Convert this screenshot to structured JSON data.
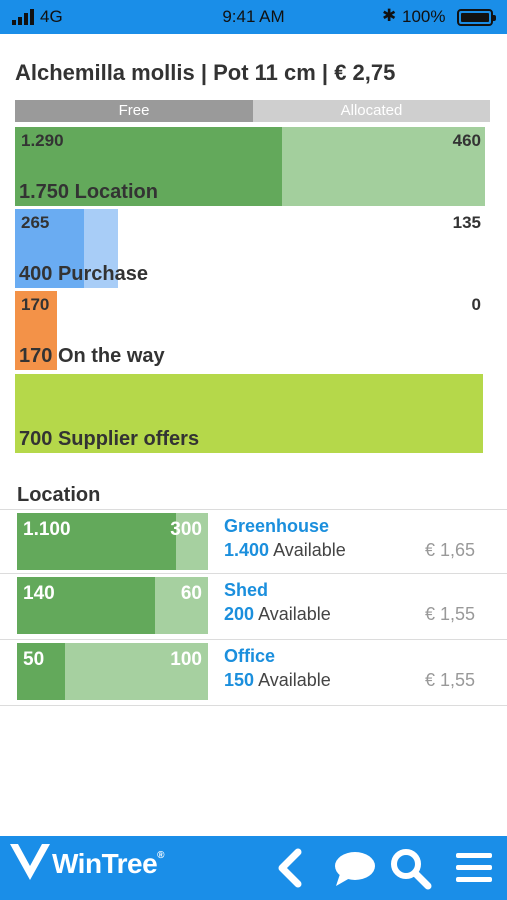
{
  "status_bar": {
    "network": "4G",
    "time": "9:41 AM",
    "battery": "100%"
  },
  "product": {
    "title": "Alchemilla mollis | Pot 11 cm | € 2,75"
  },
  "legend": {
    "free": "Free",
    "allocated": "Allocated"
  },
  "stock_rows": [
    {
      "free": "1.290",
      "allocated": "460",
      "total": "1.750",
      "label": "Location",
      "color_free": "#63a95b",
      "color_alloc": "#a3cf9d"
    },
    {
      "free": "265",
      "allocated": "135",
      "total": "400",
      "label": "Purchase",
      "color_free": "#6aacf2",
      "color_alloc": "#a8cdf7"
    },
    {
      "free": "170",
      "allocated": "0",
      "total": "170",
      "label": "On the way",
      "color_free": "#f39248",
      "color_alloc": "#f8c19a"
    },
    {
      "free": "",
      "allocated": "",
      "total": "700",
      "label": "Supplier offers",
      "color_free": "#b5d84a",
      "color_alloc": "#b5d84a"
    }
  ],
  "locations_section": {
    "title": "Location",
    "items": [
      {
        "free": "1.100",
        "allocated": "300",
        "name": "Greenhouse",
        "available": "1.400",
        "available_label": "Available",
        "price": "€ 1,65",
        "fill_fraction": 0.83
      },
      {
        "free": "140",
        "allocated": "60",
        "name": "Shed",
        "available": "200",
        "available_label": "Available",
        "price": "€ 1,55",
        "fill_fraction": 0.72
      },
      {
        "free": "50",
        "allocated": "100",
        "name": "Office",
        "available": "150",
        "available_label": "Available",
        "price": "€ 1,55",
        "fill_fraction": 0.25
      }
    ]
  },
  "footer": {
    "brand": "WinTree",
    "icons": [
      "back-icon",
      "chat-icon",
      "search-icon",
      "menu-icon"
    ]
  }
}
